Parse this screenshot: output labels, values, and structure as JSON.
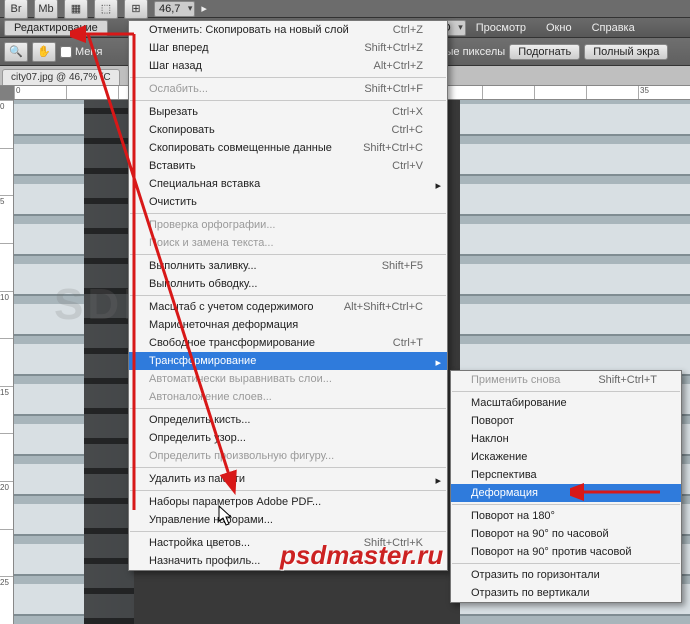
{
  "topIcons": {
    "br": "Br",
    "mb": "Mb",
    "zoom": "46,7",
    "arrowR": "▸"
  },
  "menubar": {
    "highlight": "Редактирование",
    "items": [
      "Просмотр",
      "Окно",
      "Справка"
    ]
  },
  "optbar": {
    "magnify": "🔍",
    "hand": "✋",
    "chk1": "Меня",
    "chk2": "вальные пикселы",
    "btn1": "Подогнать",
    "btn2": "Полный экра"
  },
  "tab": {
    "title": "city07.jpg @ 46,7% (С"
  },
  "ruler_h": [
    "0",
    "",
    "",
    "",
    "",
    "",
    "",
    "",
    "",
    "",
    "",
    "",
    "35"
  ],
  "ruler_v": [
    "0",
    "",
    "5",
    "",
    "10",
    "",
    "15",
    "",
    "20",
    "",
    "25"
  ],
  "watermarkText": "psdmaster.ru",
  "wmBg": "SDELAT.OR",
  "menu1": {
    "items": [
      {
        "label": "Отменить: Скопировать на новый слой",
        "sc": "Ctrl+Z",
        "dis": false
      },
      {
        "label": "Шаг вперед",
        "sc": "Shift+Ctrl+Z",
        "dis": false
      },
      {
        "label": "Шаг назад",
        "sc": "Alt+Ctrl+Z",
        "dis": false
      },
      {
        "sep": true
      },
      {
        "label": "Ослабить...",
        "sc": "Shift+Ctrl+F",
        "dis": true
      },
      {
        "sep": true
      },
      {
        "label": "Вырезать",
        "sc": "Ctrl+X",
        "dis": false
      },
      {
        "label": "Скопировать",
        "sc": "Ctrl+C",
        "dis": false
      },
      {
        "label": "Скопировать совмещенные данные",
        "sc": "Shift+Ctrl+C",
        "dis": false
      },
      {
        "label": "Вставить",
        "sc": "Ctrl+V",
        "dis": false
      },
      {
        "label": "Специальная вставка",
        "sc": "",
        "sub": true,
        "dis": false
      },
      {
        "label": "Очистить",
        "sc": "",
        "dis": false
      },
      {
        "sep": true
      },
      {
        "label": "Проверка орфографии...",
        "sc": "",
        "dis": true
      },
      {
        "label": "Поиск и замена текста...",
        "sc": "",
        "dis": true
      },
      {
        "sep": true
      },
      {
        "label": "Выполнить заливку...",
        "sc": "Shift+F5",
        "dis": false
      },
      {
        "label": "Выполнить обводку...",
        "sc": "",
        "dis": false
      },
      {
        "sep": true
      },
      {
        "label": "Масштаб с учетом содержимого",
        "sc": "Alt+Shift+Ctrl+C",
        "dis": false
      },
      {
        "label": "Марионеточная деформация",
        "sc": "",
        "dis": false
      },
      {
        "label": "Свободное трансформирование",
        "sc": "Ctrl+T",
        "dis": false
      },
      {
        "label": "Трансформирование",
        "sc": "",
        "sub": true,
        "dis": false,
        "sel": true
      },
      {
        "label": "Автоматически выравнивать слои...",
        "sc": "",
        "dis": true
      },
      {
        "label": "Автоналожение слоев...",
        "sc": "",
        "dis": true
      },
      {
        "sep": true
      },
      {
        "label": "Определить кисть...",
        "sc": "",
        "dis": false
      },
      {
        "label": "Определить узор...",
        "sc": "",
        "dis": false
      },
      {
        "label": "Определить произвольную фигуру...",
        "sc": "",
        "dis": true
      },
      {
        "sep": true
      },
      {
        "label": "Удалить из памяти",
        "sc": "",
        "sub": true,
        "dis": false
      },
      {
        "sep": true
      },
      {
        "label": "Наборы параметров Adobe PDF...",
        "sc": "",
        "dis": false
      },
      {
        "label": "Управление наборами...",
        "sc": "",
        "dis": false
      },
      {
        "sep": true
      },
      {
        "label": "Настройка цветов...",
        "sc": "Shift+Ctrl+K",
        "dis": false
      },
      {
        "label": "Назначить профиль...",
        "sc": "",
        "dis": false
      }
    ]
  },
  "menu2": {
    "items": [
      {
        "label": "Применить снова",
        "sc": "Shift+Ctrl+T",
        "dis": true
      },
      {
        "sep": true
      },
      {
        "label": "Масштабирование",
        "sc": "",
        "dis": false
      },
      {
        "label": "Поворот",
        "sc": "",
        "dis": false
      },
      {
        "label": "Наклон",
        "sc": "",
        "dis": false
      },
      {
        "label": "Искажение",
        "sc": "",
        "dis": false
      },
      {
        "label": "Перспектива",
        "sc": "",
        "dis": false
      },
      {
        "label": "Деформация",
        "sc": "",
        "dis": false,
        "sel": true
      },
      {
        "sep": true
      },
      {
        "label": "Поворот на 180°",
        "sc": "",
        "dis": false
      },
      {
        "label": "Поворот на 90° по часовой",
        "sc": "",
        "dis": false
      },
      {
        "label": "Поворот на 90° против часовой",
        "sc": "",
        "dis": false
      },
      {
        "sep": true
      },
      {
        "label": "Отразить по горизонтали",
        "sc": "",
        "dis": false
      },
      {
        "label": "Отразить по вертикали",
        "sc": "",
        "dis": false
      }
    ]
  }
}
